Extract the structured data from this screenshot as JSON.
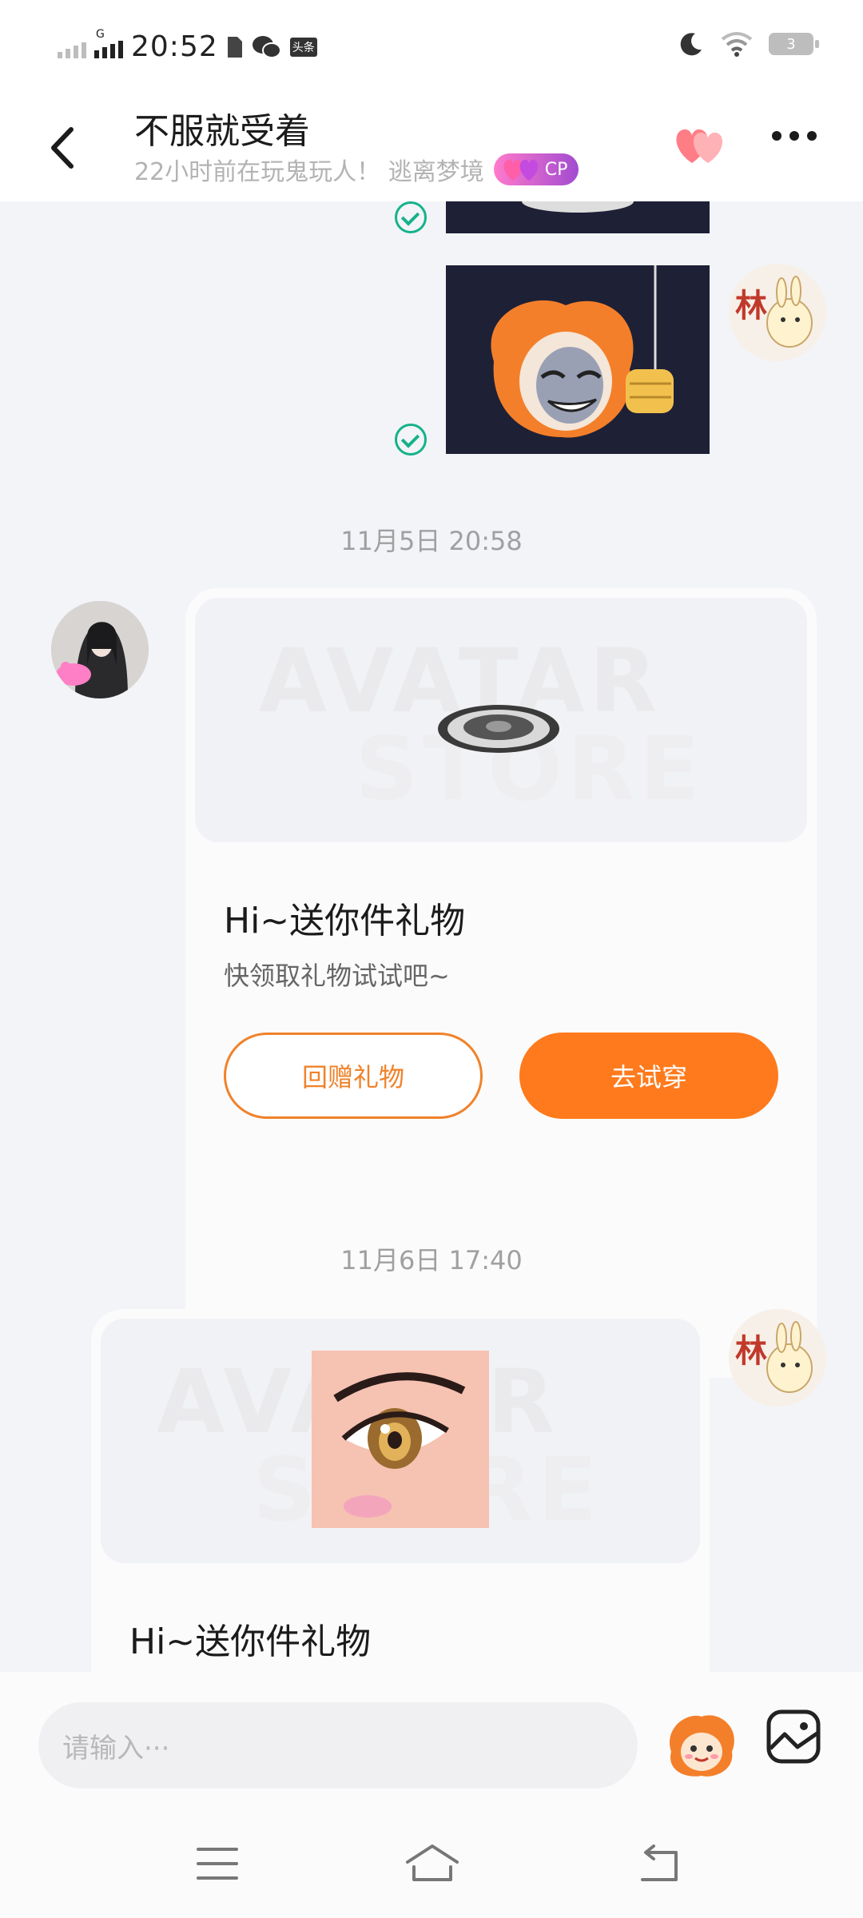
{
  "status_bar": {
    "time": "20:52",
    "network": "G",
    "battery": "3",
    "app_badge": "头条"
  },
  "header": {
    "title": "不服就受着",
    "subtitle": "22小时前在玩鬼玩人！ 逃离梦境",
    "cp_badge": "CP"
  },
  "messages": {
    "timestamp_1": "11月5日 20:58",
    "timestamp_2": "11月6日 17:40",
    "avatar_text": "林",
    "card1": {
      "watermark_1": "AVATAR",
      "watermark_2": "STORE",
      "title": "Hi~送你件礼物",
      "desc": "快领取礼物试试吧~",
      "btn_return": "回赠礼物",
      "btn_try": "去试穿"
    },
    "card2": {
      "watermark_1": "AVATAR",
      "watermark_2": "STORE",
      "title": "Hi~送你件礼物"
    }
  },
  "input": {
    "placeholder": "请输入···"
  },
  "colors": {
    "accent": "#ff7a1c",
    "check": "#15b28a",
    "cp_gradient_start": "#ff7acb",
    "cp_gradient_end": "#a24bd1"
  }
}
